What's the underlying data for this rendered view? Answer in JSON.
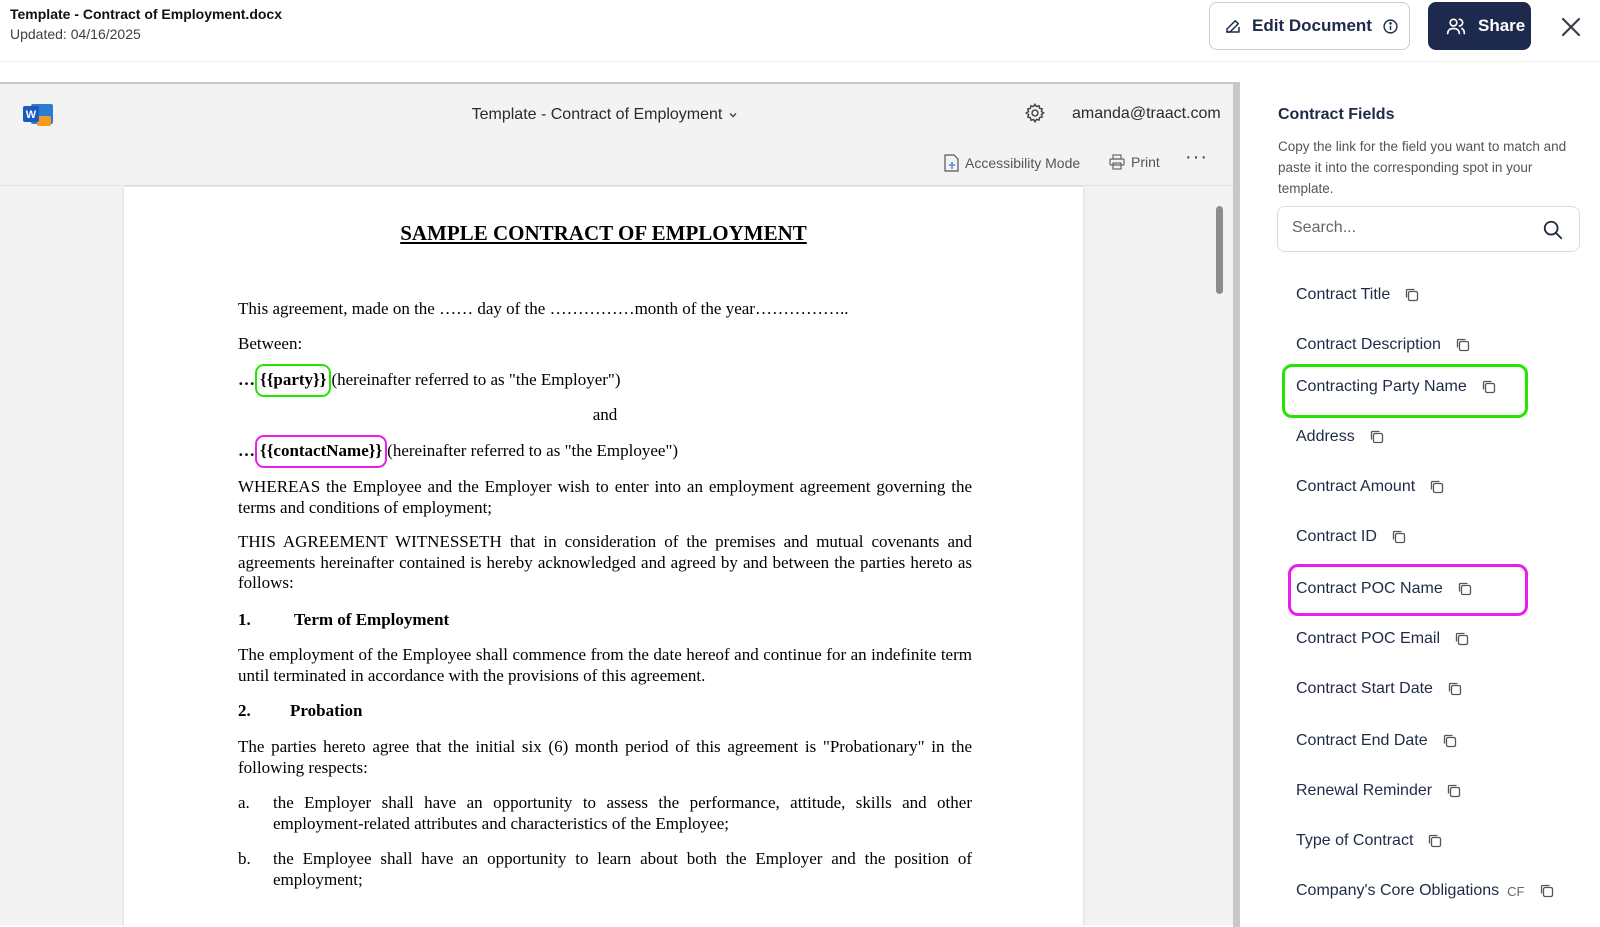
{
  "header": {
    "file_title": "Template - Contract of Employment.docx",
    "updated": "Updated: 04/16/2025",
    "edit_label": "Edit Document",
    "share_label": "Share"
  },
  "viewer": {
    "doc_name": "Template - Contract of Employment",
    "user_email": "amanda@traact.com",
    "accessibility_label": "Accessibility Mode",
    "print_label": "Print",
    "more_label": "···"
  },
  "document": {
    "title": "SAMPLE CONTRACT OF EMPLOYMENT",
    "intro": "This agreement, made on the …… day of the ……………month of the year……………..",
    "between": "Between:",
    "party_prefix": "…",
    "party_placeholder": "{{party}}",
    "party_suffix": "(hereinafter referred to as \"the Employer\")",
    "and": "and",
    "contact_prefix": "…",
    "contact_placeholder": "{{contactName}}",
    "contact_suffix": "(hereinafter referred to as \"the Employee\")",
    "whereas": "WHEREAS the Employee and the Employer wish to enter into an employment agreement governing the terms and conditions of employment;",
    "witnesseth": "THIS AGREEMENT WITNESSETH that in consideration of the premises and mutual covenants and agreements hereinafter contained is hereby acknowledged and agreed by and between the parties hereto as follows:",
    "sec1_num": "1.",
    "sec1_title": "Term of Employment",
    "sec1_text": "The employment of the Employee shall commence from the date hereof and continue for an indefinite term until terminated in accordance with the provisions of this agreement.",
    "sec2_num": "2.",
    "sec2_title": "Probation",
    "sec2_text": "The parties hereto agree that the initial six (6) month period of this agreement is \"Probationary\" in the following respects:",
    "item_a_marker": "a.",
    "item_a_text": "the Employer shall have an opportunity to assess the performance, attitude, skills and other employment-related attributes and characteristics of the Employee;",
    "item_b_marker": "b.",
    "item_b_text": "the Employee shall have an opportunity to learn about both the Employer and the position of employment;"
  },
  "panel": {
    "title": "Contract Fields",
    "description": "Copy the link for the field you want to match and paste it into the corresponding spot in your template.",
    "search_placeholder": "Search...",
    "fields": [
      {
        "label": "Contract Title"
      },
      {
        "label": "Contract Description"
      },
      {
        "label": "Contracting Party Name"
      },
      {
        "label": "Address"
      },
      {
        "label": "Contract Amount"
      },
      {
        "label": "Contract ID"
      },
      {
        "label": "Contract POC Name"
      },
      {
        "label": "Contract POC Email"
      },
      {
        "label": "Contract Start Date"
      },
      {
        "label": "Contract End Date"
      },
      {
        "label": "Renewal Reminder"
      },
      {
        "label": "Type of Contract"
      },
      {
        "label": "Company's Core Obligations",
        "badge": "CF"
      }
    ]
  },
  "colors": {
    "highlight_green": "#22e600",
    "highlight_magenta": "#e91ee9",
    "share_bg": "#1d2a4d"
  }
}
